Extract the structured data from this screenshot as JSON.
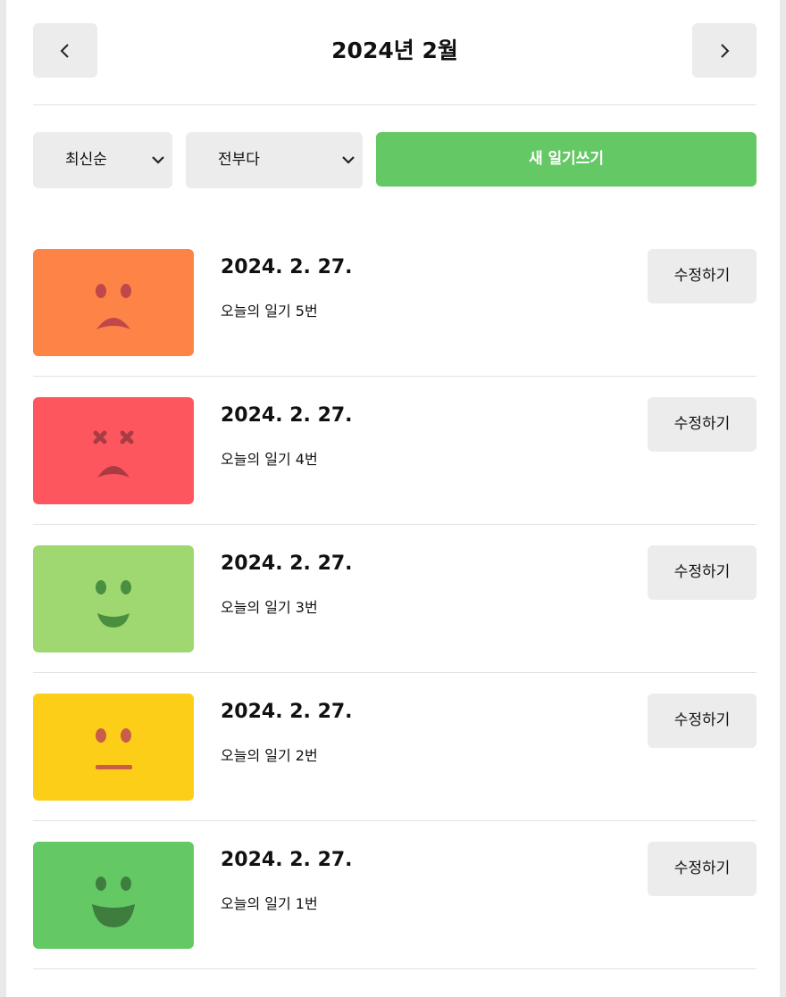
{
  "header": {
    "title": "2024년 2월",
    "prev_icon": "chevron-left-icon",
    "next_icon": "chevron-right-icon"
  },
  "controls": {
    "sort_value": "최신순",
    "filter_value": "전부다",
    "new_button_label": "새 일기쓰기",
    "dropdown_icon": "chevron-down-icon"
  },
  "colors": {
    "accent": "#64c964",
    "button_bg": "#ececec",
    "mood_1": "#64c964",
    "mood_2": "#9fd871",
    "mood_3": "#fdce17",
    "mood_4": "#fd8446",
    "mood_5": "#fd565f"
  },
  "diary_list": [
    {
      "date": "2024. 2. 27.",
      "content": "오늘의 일기 5번",
      "mood": "sad-face-icon",
      "color": "#fd8446",
      "edit_label": "수정하기"
    },
    {
      "date": "2024. 2. 27.",
      "content": "오늘의 일기 4번",
      "mood": "terrible-face-icon",
      "color": "#fd565f",
      "edit_label": "수정하기"
    },
    {
      "date": "2024. 2. 27.",
      "content": "오늘의 일기 3번",
      "mood": "smile-face-icon",
      "color": "#9fd871",
      "edit_label": "수정하기"
    },
    {
      "date": "2024. 2. 27.",
      "content": "오늘의 일기 2번",
      "mood": "neutral-face-icon",
      "color": "#fdce17",
      "edit_label": "수정하기"
    },
    {
      "date": "2024. 2. 27.",
      "content": "오늘의 일기 1번",
      "mood": "happy-face-icon",
      "color": "#64c964",
      "edit_label": "수정하기"
    }
  ]
}
